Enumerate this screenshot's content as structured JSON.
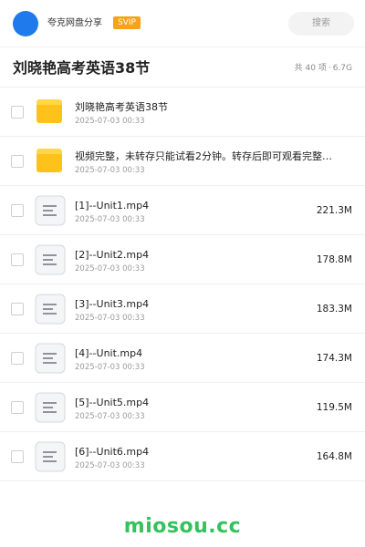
{
  "header": {
    "brand": "夸克网盘分享",
    "badge": "SVIP",
    "search_label": "搜索"
  },
  "folder": {
    "title": "刘晓艳高考英语38节",
    "item_count": "共 40 项",
    "total_size": "6.7G"
  },
  "files": [
    {
      "type": "folder",
      "name": "刘晓艳高考英语38节",
      "date": "2025-07-03 00:33",
      "size": ""
    },
    {
      "type": "folder",
      "name": "视频完整，未转存只能试看2分钟。转存后即可观看完整…",
      "date": "2025-07-03 00:33",
      "size": ""
    },
    {
      "type": "file",
      "name": "[1]--Unit1.mp4",
      "date": "2025-07-03 00:33",
      "size": "221.3M"
    },
    {
      "type": "file",
      "name": "[2]--Unit2.mp4",
      "date": "2025-07-03 00:33",
      "size": "178.8M"
    },
    {
      "type": "file",
      "name": "[3]--Unit3.mp4",
      "date": "2025-07-03 00:33",
      "size": "183.3M"
    },
    {
      "type": "file",
      "name": "[4]--Unit.mp4",
      "date": "2025-07-03 00:33",
      "size": "174.3M"
    },
    {
      "type": "file",
      "name": "[5]--Unit5.mp4",
      "date": "2025-07-03 00:33",
      "size": "119.5M"
    },
    {
      "type": "file",
      "name": "[6]--Unit6.mp4",
      "date": "2025-07-03 00:33",
      "size": "164.8M"
    }
  ],
  "watermark": "miosou.cc",
  "colors": {
    "avatar": "#1f7aec",
    "badge": "#f6a31b",
    "folder": "#ffc21a",
    "watermark": "#33c25b"
  }
}
